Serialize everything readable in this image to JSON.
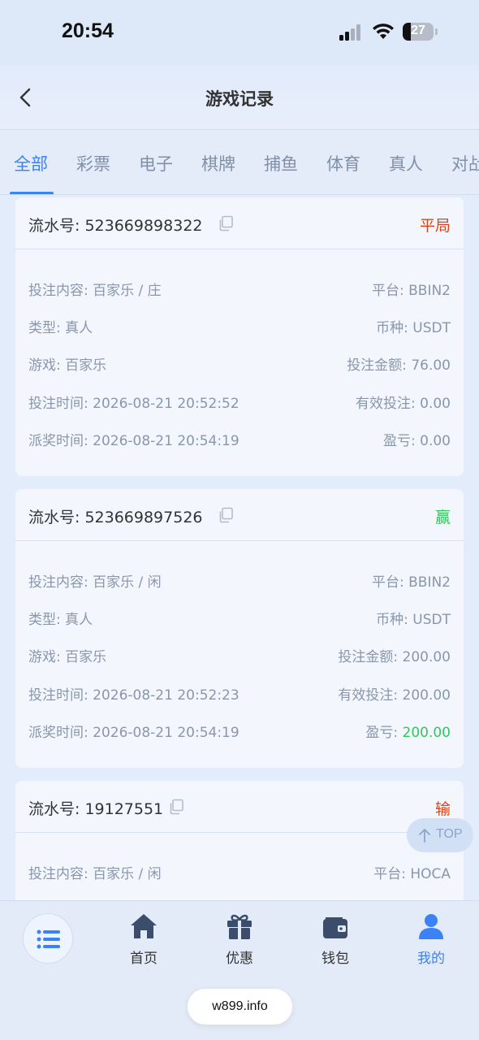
{
  "status_bar": {
    "time": "20:54",
    "battery": "27"
  },
  "header": {
    "title": "游戏记录"
  },
  "tabs": [
    "全部",
    "彩票",
    "电子",
    "棋牌",
    "捕鱼",
    "体育",
    "真人",
    "对战"
  ],
  "records": [
    {
      "serial_label": "流水号: 523669898322",
      "result": "平局",
      "bet_content": "投注内容: 百家乐 / 庄",
      "platform": "平台: BBIN2",
      "type": "类型: 真人",
      "currency": "币种: USDT",
      "game": "游戏: 百家乐",
      "bet_amount": "投注金额: 76.00",
      "bet_time": "投注时间: 2026-08-21 20:52:52",
      "valid_bet": "有效投注: 0.00",
      "payout_time": "派奖时间: 2026-08-21 20:54:19",
      "profit_label": "盈亏: ",
      "profit_value": "0.00"
    },
    {
      "serial_label": "流水号: 523669897526",
      "result": "赢",
      "bet_content": "投注内容: 百家乐 / 闲",
      "platform": "平台: BBIN2",
      "type": "类型: 真人",
      "currency": "币种: USDT",
      "game": "游戏: 百家乐",
      "bet_amount": "投注金额: 200.00",
      "bet_time": "投注时间: 2026-08-21 20:52:23",
      "valid_bet": "有效投注: 200.00",
      "payout_time": "派奖时间: 2026-08-21 20:54:19",
      "profit_label": "盈亏: ",
      "profit_value": "200.00"
    },
    {
      "serial_label": "流水号: 19127551",
      "result": "输",
      "bet_content": "投注内容: 百家乐 / 闲",
      "platform": "平台: HOCA"
    }
  ],
  "top_button": "TOP",
  "bottom_nav": [
    {
      "label": "首页",
      "icon": "home-icon"
    },
    {
      "label": "优惠",
      "icon": "gift-icon"
    },
    {
      "label": "钱包",
      "icon": "wallet-icon"
    },
    {
      "label": "我的",
      "icon": "user-icon"
    }
  ],
  "url_bar": "w899.info",
  "colors": {
    "accent": "#3b82f6",
    "draw": "#d9441c",
    "win": "#2fc85a",
    "lose": "#d9441c"
  }
}
